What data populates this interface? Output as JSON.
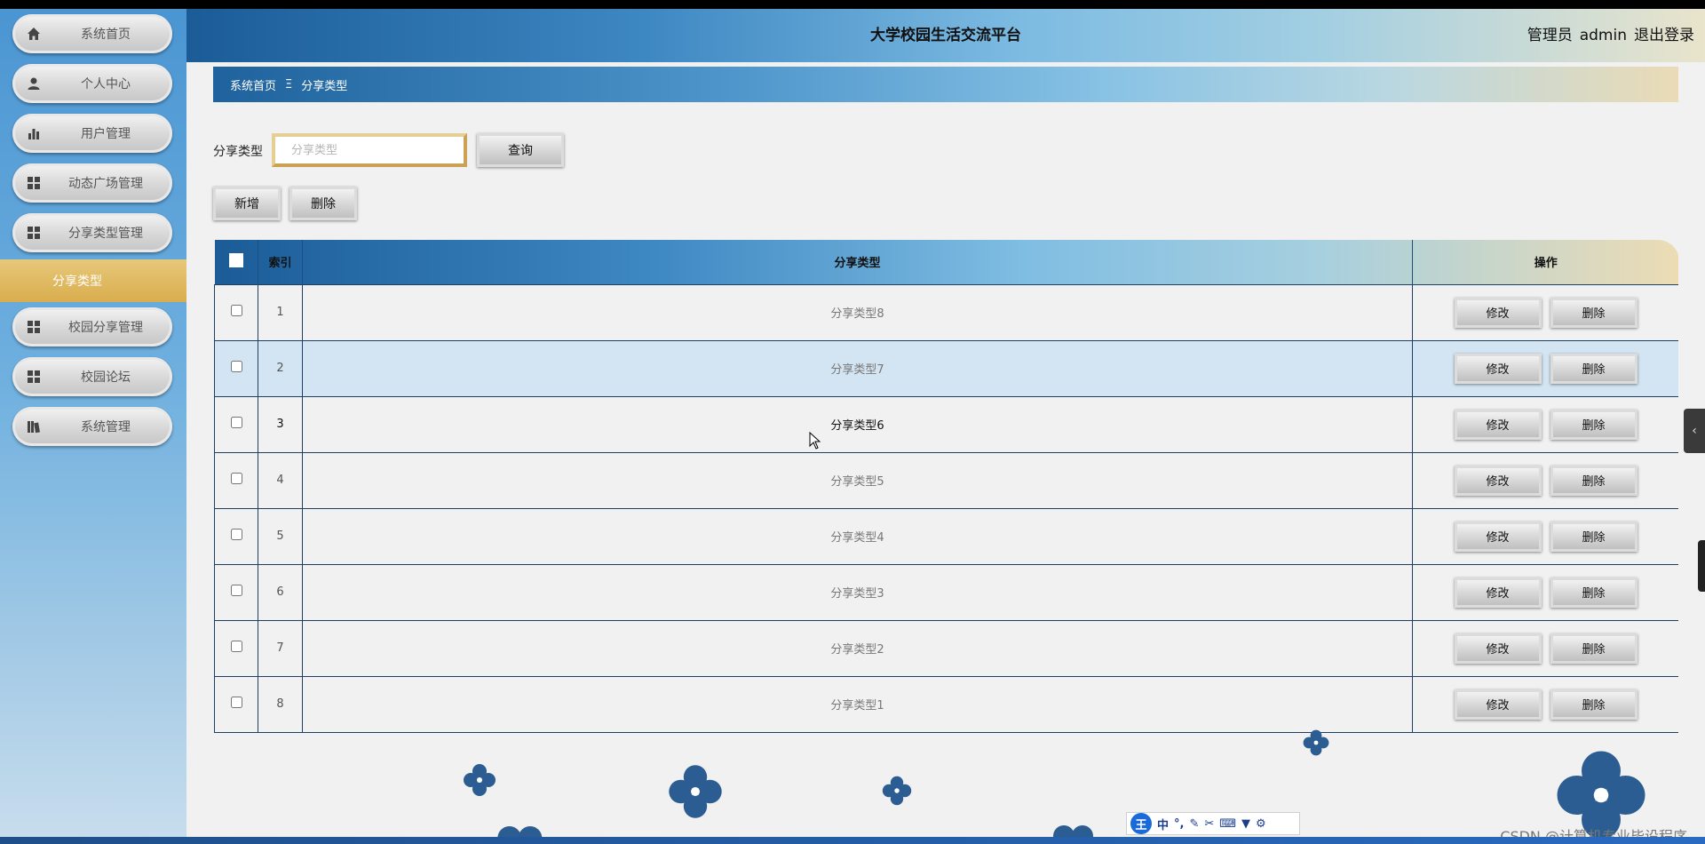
{
  "header": {
    "title": "大学校园生活交流平台",
    "role": "管理员",
    "username": "admin",
    "logout": "退出登录"
  },
  "sidebar": {
    "items": [
      {
        "label": "系统首页",
        "icon": "home-icon"
      },
      {
        "label": "个人中心",
        "icon": "user-icon"
      },
      {
        "label": "用户管理",
        "icon": "bar-chart-icon"
      },
      {
        "label": "动态广场管理",
        "icon": "grid-icon"
      },
      {
        "label": "分享类型管理",
        "icon": "grid-icon"
      },
      {
        "label": "校园分享管理",
        "icon": "grid-icon"
      },
      {
        "label": "校园论坛",
        "icon": "grid-icon"
      },
      {
        "label": "系统管理",
        "icon": "book-icon"
      }
    ],
    "active_submenu": "分享类型"
  },
  "breadcrumb": {
    "home": "系统首页",
    "separator": "Ξ",
    "current": "分享类型"
  },
  "search": {
    "label": "分享类型",
    "placeholder": "分享类型",
    "value": "",
    "button": "查询"
  },
  "actions": {
    "add": "新增",
    "delete": "删除"
  },
  "table": {
    "columns": [
      "索引",
      "分享类型",
      "操作"
    ],
    "edit_label": "修改",
    "delete_label": "删除",
    "rows": [
      {
        "index": "1",
        "name": "分享类型8"
      },
      {
        "index": "2",
        "name": "分享类型7"
      },
      {
        "index": "3",
        "name": "分享类型6"
      },
      {
        "index": "4",
        "name": "分享类型5"
      },
      {
        "index": "5",
        "name": "分享类型4"
      },
      {
        "index": "6",
        "name": "分享类型3"
      },
      {
        "index": "7",
        "name": "分享类型2"
      },
      {
        "index": "8",
        "name": "分享类型1"
      }
    ]
  },
  "ime_toolbar": {
    "logo": "王",
    "mode": "中"
  },
  "watermark": "CSDN @计算机专业毕设程序",
  "colors": {
    "accent_blue": "#2f78b8",
    "active_gold": "#d9ad4e",
    "decor_flower": "#2b5d92"
  }
}
